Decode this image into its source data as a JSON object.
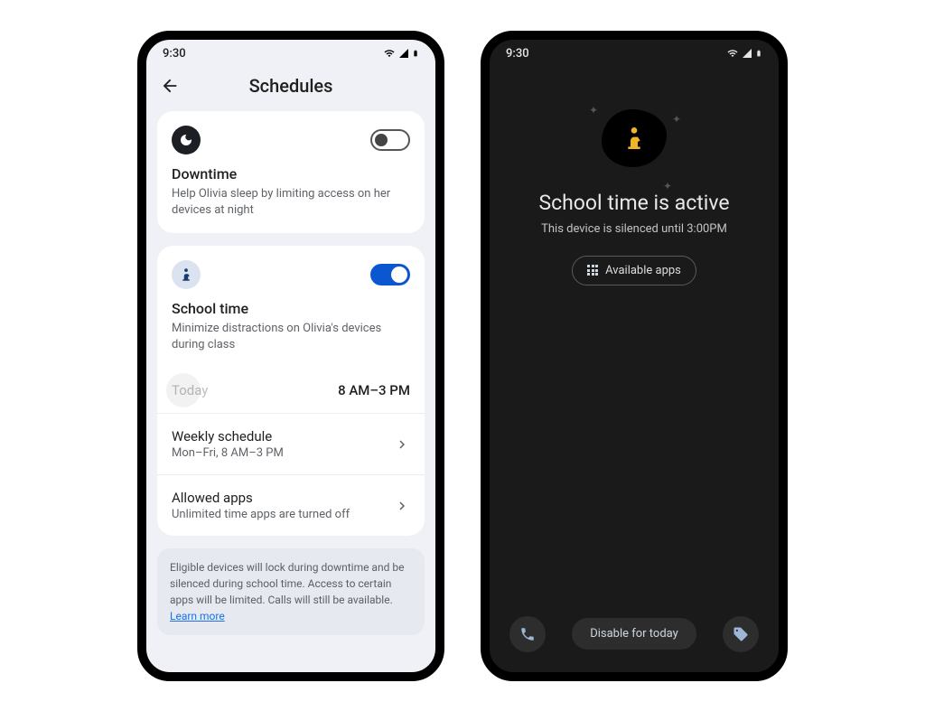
{
  "status": {
    "time": "9:30"
  },
  "left": {
    "title": "Schedules",
    "downtime": {
      "title": "Downtime",
      "desc": "Help Olivia sleep by limiting access on her devices at night",
      "enabled": false
    },
    "schooltime": {
      "title": "School time",
      "desc": "Minimize distractions on Olivia's devices during class",
      "enabled": true,
      "today_label": "Today",
      "today_value": "8 AM–3 PM",
      "weekly_title": "Weekly schedule",
      "weekly_sub": "Mon–Fri, 8 AM–3 PM",
      "allowed_title": "Allowed apps",
      "allowed_sub": "Unlimited time apps are turned off"
    },
    "info": "Eligible devices will lock during downtime and be silenced during school time. Access to certain apps will be limited. Calls will still be available.",
    "learn_more": "Learn more"
  },
  "right": {
    "title": "School time is active",
    "subtitle": "This device is silenced until 3:00PM",
    "available_apps": "Available apps",
    "disable": "Disable for today"
  }
}
